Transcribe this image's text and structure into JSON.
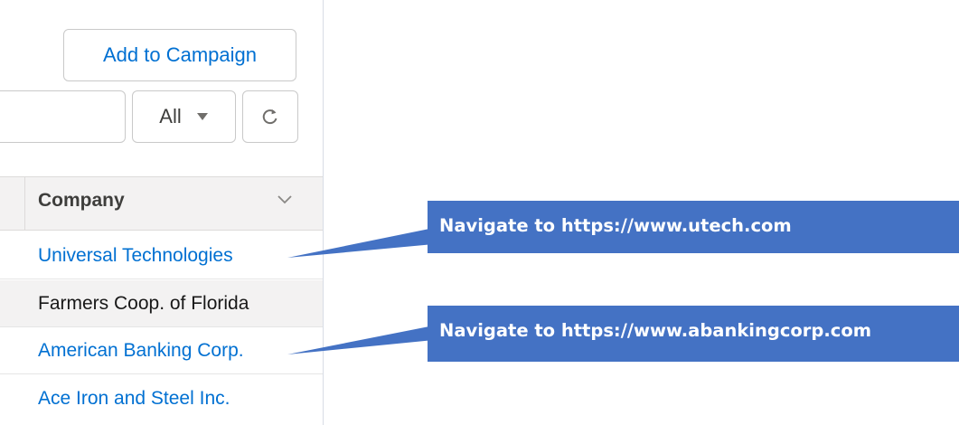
{
  "toolbar": {
    "add_to_campaign_label": "Add to Campaign",
    "filter_value": "All",
    "search_value": ""
  },
  "table": {
    "column_header": "Company",
    "rows": [
      {
        "company": "Universal Technologies",
        "is_link": true
      },
      {
        "company": "Farmers Coop. of Florida",
        "is_link": false
      },
      {
        "company": "American Banking Corp.",
        "is_link": true
      },
      {
        "company": "Ace Iron and Steel Inc.",
        "is_link": true
      }
    ]
  },
  "annotations": [
    {
      "text": "Navigate to https://www.utech.com",
      "target_row": 0
    },
    {
      "text": "Navigate to https://www.abankingcorp.com",
      "target_row": 2
    }
  ],
  "icons": {
    "filter_dropdown": "caret-down-icon",
    "refresh": "refresh-icon",
    "column_menu": "chevron-down-icon"
  },
  "colors": {
    "link": "#0070d2",
    "callout_fill": "#4472c4",
    "header_bg": "#f3f2f2",
    "text": "#181818"
  }
}
